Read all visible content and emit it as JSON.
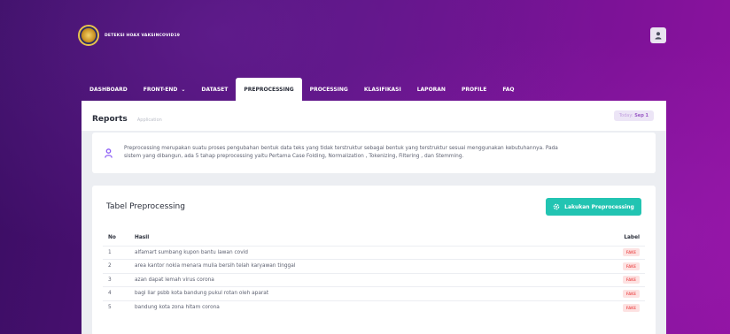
{
  "header": {
    "brand_name": "DETEKSI HOAX VAKSINCOVID19",
    "logo_icon": "university-seal-icon",
    "user_icon": "user-icon"
  },
  "nav": {
    "items": [
      {
        "label": "DASHBOARD",
        "active": false
      },
      {
        "label": "FRONT-END",
        "active": false,
        "dropdown": true
      },
      {
        "label": "DATASET",
        "active": false
      },
      {
        "label": "PREPROCESSING",
        "active": true
      },
      {
        "label": "PROCESSING",
        "active": false
      },
      {
        "label": "KLASIFIKASI",
        "active": false
      },
      {
        "label": "LAPORAN",
        "active": false
      },
      {
        "label": "PROFILE",
        "active": false
      },
      {
        "label": "FAQ",
        "active": false
      }
    ],
    "dropdown_caret": "⌄"
  },
  "reports": {
    "title": "Reports",
    "subtitle": "Application",
    "today_label": "Today:",
    "today_value": "Sep 1"
  },
  "info": {
    "icon": "user-pin-icon",
    "text_line1": "Preprocessing merupakan suatu proses pengubahan bentuk data teks yang tidak terstruktur sebagai bentuk yang terstruktur sesuai menggunakan kebutuhannya. Pada",
    "text_line2": "sistem yang dibangun, ada 5 tahap preprocessing yaitu Pertama Case Folding, Normalization , Tokenizing, Filtering , dan Stemming."
  },
  "table": {
    "title": "Tabel Preprocessing",
    "action_label": "Lakukan Preprocessing",
    "action_icon": "cog-icon",
    "columns": {
      "no": "No",
      "hasil": "Hasil",
      "label": "Label"
    },
    "rows": [
      {
        "no": "1",
        "hasil": "alfamart sumbang kupon bantu lawan covid",
        "label": "FAKE"
      },
      {
        "no": "2",
        "hasil": "area kantor nokia menara mulia bersih telah karyawan tinggal",
        "label": "FAKE"
      },
      {
        "no": "3",
        "hasil": "azan dapat lemah virus corona",
        "label": "FAKE"
      },
      {
        "no": "4",
        "hasil": "bagi liar psbb kota bandung pukul rotan oleh aparat",
        "label": "FAKE"
      },
      {
        "no": "5",
        "hasil": "bandung kota zona hitam corona",
        "label": "FAKE"
      }
    ]
  },
  "colors": {
    "accent_teal": "#22c4b2",
    "badge_fake": "#ef6b6b",
    "background_purple": "#5a1180"
  }
}
